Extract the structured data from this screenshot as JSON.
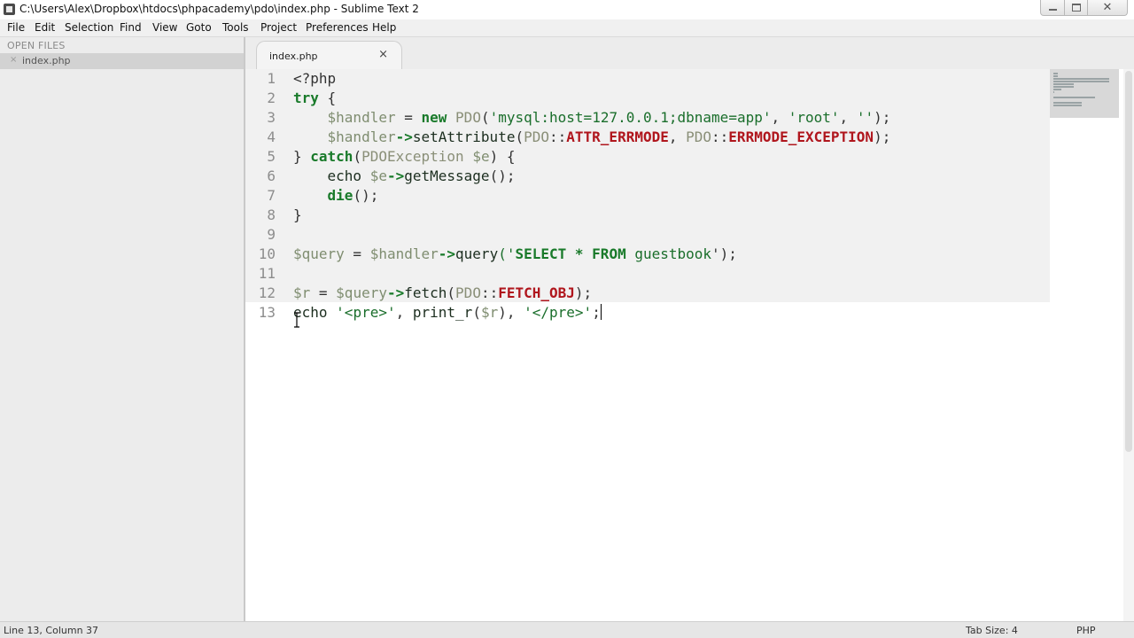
{
  "window": {
    "title": "C:\\Users\\Alex\\Dropbox\\htdocs\\phpacademy\\pdo\\index.php - Sublime Text 2",
    "minimize_glyph": "–",
    "close_glyph": "✕"
  },
  "menu": [
    "File",
    "Edit",
    "Selection",
    "Find",
    "View",
    "Goto",
    "Tools",
    "Project",
    "Preferences",
    "Help"
  ],
  "sidebar": {
    "header": "OPEN FILES",
    "files": [
      {
        "close": "×",
        "name": "index.php"
      }
    ]
  },
  "tabs": [
    {
      "label": "index.php",
      "close": "×"
    }
  ],
  "editor": {
    "lines": [
      [
        {
          "t": "<?php",
          "c": "plain"
        }
      ],
      [
        {
          "t": "try",
          "c": "kw"
        },
        {
          "t": " {",
          "c": "plain"
        }
      ],
      [
        {
          "t": "    ",
          "c": "plain"
        },
        {
          "t": "$handler",
          "c": "var"
        },
        {
          "t": " = ",
          "c": "plain"
        },
        {
          "t": "new",
          "c": "kw"
        },
        {
          "t": " ",
          "c": "plain"
        },
        {
          "t": "PDO",
          "c": "cls"
        },
        {
          "t": "(",
          "c": "plain"
        },
        {
          "t": "'mysql:host=127.0.0.1;dbname=app'",
          "c": "str"
        },
        {
          "t": ", ",
          "c": "plain"
        },
        {
          "t": "'root'",
          "c": "str"
        },
        {
          "t": ", ",
          "c": "plain"
        },
        {
          "t": "''",
          "c": "str"
        },
        {
          "t": ");",
          "c": "plain"
        }
      ],
      [
        {
          "t": "    ",
          "c": "plain"
        },
        {
          "t": "$handler",
          "c": "var"
        },
        {
          "t": "->",
          "c": "kw"
        },
        {
          "t": "setAttribute",
          "c": "fn"
        },
        {
          "t": "(",
          "c": "plain"
        },
        {
          "t": "PDO",
          "c": "cls"
        },
        {
          "t": "::",
          "c": "plain"
        },
        {
          "t": "ATTR_ERRMODE",
          "c": "const"
        },
        {
          "t": ", ",
          "c": "plain"
        },
        {
          "t": "PDO",
          "c": "cls"
        },
        {
          "t": "::",
          "c": "plain"
        },
        {
          "t": "ERRMODE_EXCEPTION",
          "c": "const"
        },
        {
          "t": ");",
          "c": "plain"
        }
      ],
      [
        {
          "t": "} ",
          "c": "plain"
        },
        {
          "t": "catch",
          "c": "kw"
        },
        {
          "t": "(",
          "c": "plain"
        },
        {
          "t": "PDOException",
          "c": "cls"
        },
        {
          "t": " ",
          "c": "plain"
        },
        {
          "t": "$e",
          "c": "var"
        },
        {
          "t": ") {",
          "c": "plain"
        }
      ],
      [
        {
          "t": "    ",
          "c": "plain"
        },
        {
          "t": "echo",
          "c": "fn"
        },
        {
          "t": " ",
          "c": "plain"
        },
        {
          "t": "$e",
          "c": "var"
        },
        {
          "t": "->",
          "c": "kw"
        },
        {
          "t": "getMessage",
          "c": "fn"
        },
        {
          "t": "();",
          "c": "plain"
        }
      ],
      [
        {
          "t": "    ",
          "c": "plain"
        },
        {
          "t": "die",
          "c": "kw"
        },
        {
          "t": "();",
          "c": "plain"
        }
      ],
      [
        {
          "t": "}",
          "c": "plain"
        }
      ],
      [
        {
          "t": "",
          "c": "plain"
        }
      ],
      [
        {
          "t": "$query",
          "c": "var"
        },
        {
          "t": " = ",
          "c": "plain"
        },
        {
          "t": "$handler",
          "c": "var"
        },
        {
          "t": "->",
          "c": "kw"
        },
        {
          "t": "query",
          "c": "fn"
        },
        {
          "t": "('",
          "c": "str"
        },
        {
          "t": "SELECT",
          "c": "kw"
        },
        {
          "t": " * ",
          "c": "kw"
        },
        {
          "t": "FROM",
          "c": "kw"
        },
        {
          "t": " guestbook",
          "c": "str"
        },
        {
          "t": "');",
          "c": "plain"
        }
      ],
      [
        {
          "t": "",
          "c": "plain"
        }
      ],
      [
        {
          "t": "$r",
          "c": "var"
        },
        {
          "t": " = ",
          "c": "plain"
        },
        {
          "t": "$query",
          "c": "var"
        },
        {
          "t": "->",
          "c": "kw"
        },
        {
          "t": "fetch",
          "c": "fn"
        },
        {
          "t": "(",
          "c": "plain"
        },
        {
          "t": "PDO",
          "c": "cls"
        },
        {
          "t": "::",
          "c": "plain"
        },
        {
          "t": "FETCH_OBJ",
          "c": "const"
        },
        {
          "t": ");",
          "c": "plain"
        }
      ],
      [
        {
          "t": "echo",
          "c": "fn"
        },
        {
          "t": " ",
          "c": "plain"
        },
        {
          "t": "'<pre>'",
          "c": "str"
        },
        {
          "t": ", ",
          "c": "plain"
        },
        {
          "t": "print_r",
          "c": "fn"
        },
        {
          "t": "(",
          "c": "plain"
        },
        {
          "t": "$r",
          "c": "var"
        },
        {
          "t": "), ",
          "c": "plain"
        },
        {
          "t": "'</pre>'",
          "c": "str"
        },
        {
          "t": ";",
          "c": "plain"
        }
      ]
    ]
  },
  "status": {
    "position": "Line 13, Column 37",
    "tab_size": "Tab Size: 4",
    "syntax": "PHP"
  },
  "colors": {
    "keyword": "#197a2a",
    "string": "#1a6e2b",
    "variable": "#7f8d70",
    "constant": "#b0161d",
    "class": "#8a8f78"
  }
}
